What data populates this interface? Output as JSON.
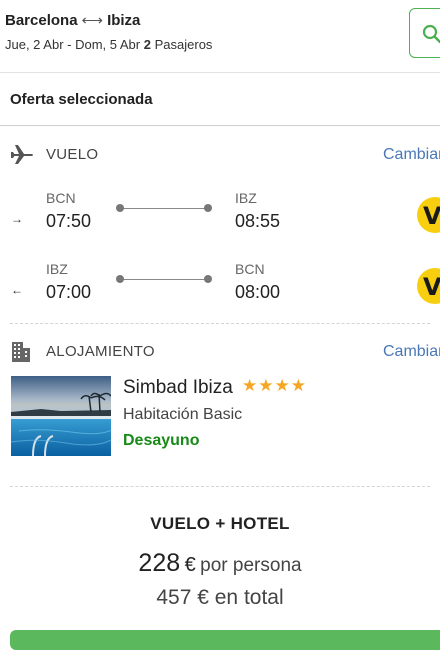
{
  "header": {
    "origin": "Barcelona",
    "destination": "Ibiza",
    "dates": "Jue, 2 Abr - Dom, 5 Abr",
    "passengers_count": "2",
    "passengers_label": "Pasajeros"
  },
  "selection": {
    "title": "Oferta seleccionada"
  },
  "flight": {
    "section_label": "VUELO",
    "change_label": "Cambiar",
    "legs": [
      {
        "direction": "→",
        "from_code": "BCN",
        "from_time": "07:50",
        "to_code": "IBZ",
        "to_time": "08:55",
        "airline_glyph": "V"
      },
      {
        "direction": "←",
        "from_code": "IBZ",
        "from_time": "07:00",
        "to_code": "BCN",
        "to_time": "08:00",
        "airline_glyph": "V"
      }
    ]
  },
  "accommodation": {
    "section_label": "ALOJAMIENTO",
    "change_label": "Cambiar",
    "hotel_name": "Simbad Ibiza",
    "stars": "★★★★",
    "room": "Habitación Basic",
    "board": "Desayuno"
  },
  "summary": {
    "package_label": "VUELO + HOTEL",
    "price_pp": "228",
    "currency": "€",
    "per_person_label": "por persona",
    "total_text": "457 € en total"
  },
  "colors": {
    "accent_green": "#4caf50",
    "link_blue": "#4a78b6",
    "board_green": "#188a18",
    "star_orange": "#f5a623"
  },
  "icons": [
    "search-icon",
    "plane-icon",
    "building-icon",
    "arrow-right-icon",
    "arrow-left-icon",
    "airline-logo-icon"
  ]
}
